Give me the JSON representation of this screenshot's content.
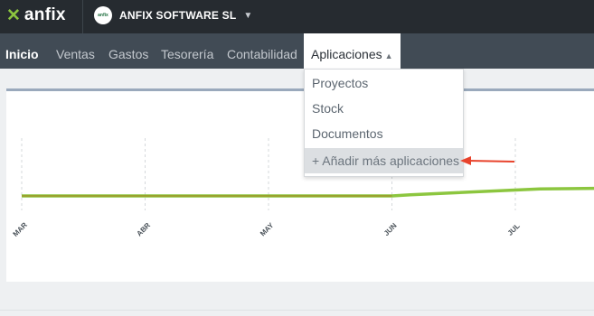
{
  "app": {
    "brand": "anfix",
    "company": "ANFIX SOFTWARE SL",
    "company_badge": "anfix"
  },
  "nav": {
    "items": [
      {
        "label": "Inicio"
      },
      {
        "label": "Ventas"
      },
      {
        "label": "Gastos"
      },
      {
        "label": "Tesorería"
      },
      {
        "label": "Contabilidad"
      },
      {
        "label": "Aplicaciones"
      }
    ]
  },
  "dropdown": {
    "items": [
      {
        "label": "Proyectos"
      },
      {
        "label": "Stock"
      },
      {
        "label": "Documentos"
      },
      {
        "label": "+ Añadir más aplicaciones"
      }
    ]
  },
  "chart_data": {
    "type": "line",
    "categories": [
      "MAR",
      "ABR",
      "MAY",
      "JUN",
      "JUL"
    ],
    "series": [
      {
        "color": "#8cc63f",
        "points": [
          [
            0,
            0
          ],
          [
            3,
            0
          ],
          [
            3.15,
            0.02
          ],
          [
            4.2,
            0.12
          ],
          [
            4.7,
            0.13
          ]
        ]
      },
      {
        "color": "#9aa22e",
        "points": [
          [
            0,
            0
          ],
          [
            3,
            0
          ]
        ]
      }
    ],
    "grid": true
  },
  "colors": {
    "accent": "#8cc63f",
    "arrow": "#e8432c"
  }
}
